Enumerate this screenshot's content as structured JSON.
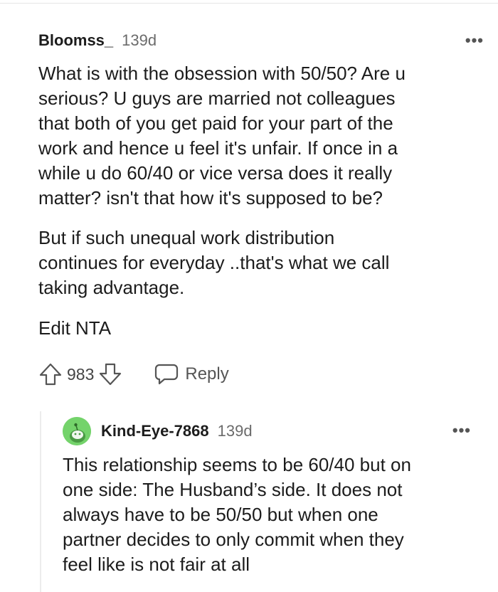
{
  "comment": {
    "username": "Bloomss_",
    "age": "139d",
    "more_label": "•••",
    "paragraphs": {
      "p1": [
        "What is with the obsession with 50/50? Are u",
        "serious? U guys are married not colleagues",
        "that both of you get paid for your part of the",
        "work and hence u feel it's unfair. If once in a",
        "while u do 60/40 or vice versa does it really",
        "matter? isn't that how it's supposed to be?"
      ],
      "p2": [
        "But if such unequal work distribution",
        "continues for everyday ..that's what we call",
        "taking advantage."
      ],
      "p3": [
        "Edit NTA"
      ]
    },
    "votes": "983",
    "reply_label": "Reply"
  },
  "reply": {
    "username": "Kind-Eye-7868",
    "age": "139d",
    "more_label": "•••",
    "lines": [
      "This relationship seems to be 60/40 but on",
      "one side: The Husband’s side. It does not",
      "always have to be 50/50 but when one",
      "partner decides to only commit when they",
      "feel like is not fair at all"
    ]
  },
  "icons": {
    "upvote": "upvote-arrow-icon",
    "downvote": "downvote-arrow-icon",
    "reply": "speech-bubble-icon",
    "more": "more-options-icon",
    "avatar": "snoo-avatar-icon"
  },
  "colors": {
    "text": "#1c1c1c",
    "meta": "#6b6b6b",
    "avatar_bg": "#74d36b",
    "thread_line": "#ececec"
  }
}
